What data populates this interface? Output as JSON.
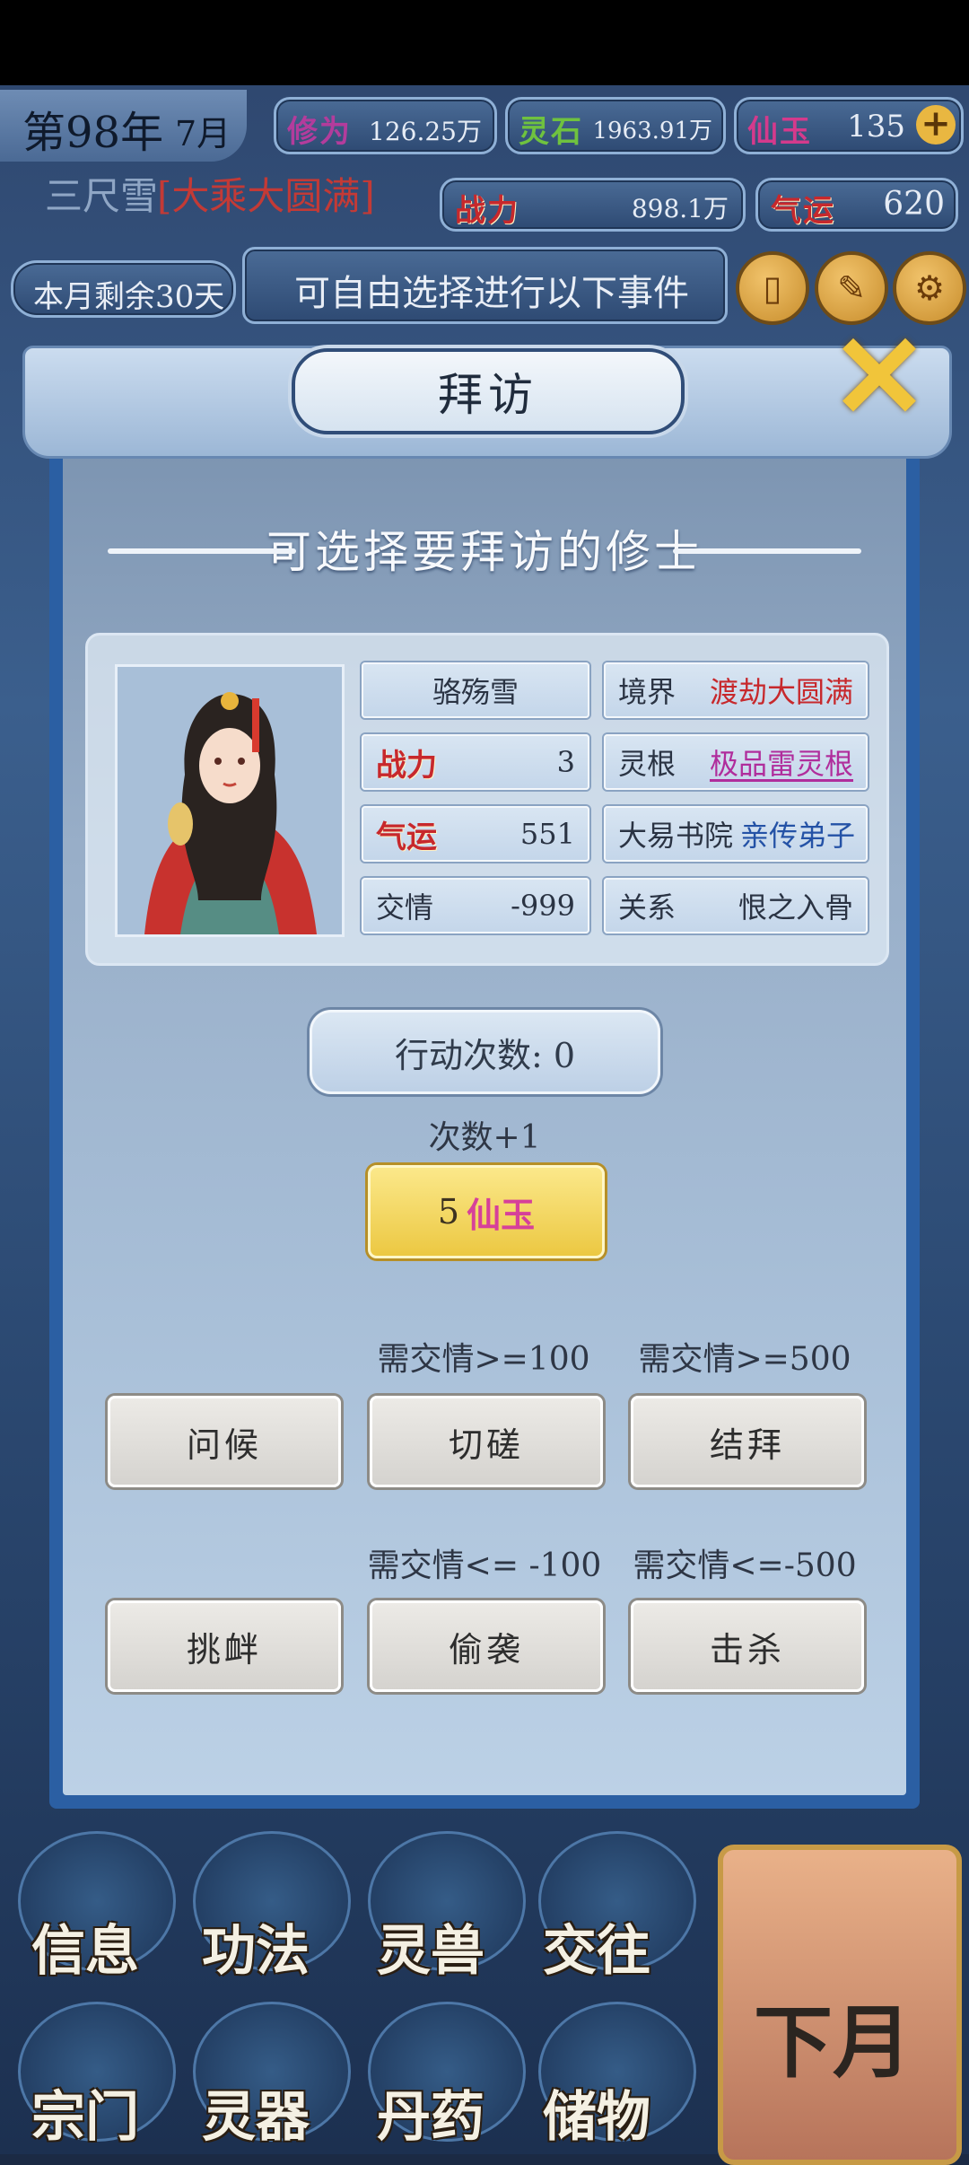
{
  "header": {
    "year": "第98年",
    "month": "7月",
    "stats": [
      {
        "label": "修为",
        "value": "126.25万"
      },
      {
        "label": "灵石",
        "value": "1963.91万"
      },
      {
        "label": "仙玉",
        "value": "135"
      }
    ],
    "player_name": "三尺雪",
    "player_realm": "[大乘大圆满]",
    "combat": {
      "label": "战力",
      "value": "898.1万"
    },
    "luck": {
      "label": "气运",
      "value": "620"
    },
    "days_left": "本月剩余30天",
    "event_text": "可自由选择进行以下事件"
  },
  "dialog": {
    "title": "拜访",
    "subtitle": "可选择要拜访的修士",
    "npc": {
      "name": "骆殇雪",
      "realm_label": "境界",
      "realm_value": "渡劫大圆满",
      "combat_label": "战力",
      "combat_value": "3",
      "root_label": "灵根",
      "root_value": "极品雷灵根",
      "luck_label": "气运",
      "luck_value": "551",
      "sect": "大易书院",
      "sect_role": "亲传弟子",
      "favor_label": "交情",
      "favor_value": "-999",
      "relation_label": "关系",
      "relation_value": "恨之入骨"
    },
    "action_count": "行动次数: 0",
    "plus_note": "次数+1",
    "pay": {
      "amount": "5",
      "currency": "仙玉"
    },
    "actions_row1": [
      {
        "label": "问候",
        "req": ""
      },
      {
        "label": "切磋",
        "req": "需交情>=100"
      },
      {
        "label": "结拜",
        "req": "需交情>=500"
      }
    ],
    "actions_row2": [
      {
        "label": "挑衅",
        "req": ""
      },
      {
        "label": "偷袭",
        "req": "需交情<= -100"
      },
      {
        "label": "击杀",
        "req": "需交情<=-500"
      }
    ]
  },
  "bottom_nav": {
    "row1": [
      "信息",
      "功法",
      "灵兽",
      "交往"
    ],
    "row2": [
      "宗门",
      "灵器",
      "丹药",
      "储物"
    ],
    "next": "下月"
  },
  "colors": {
    "accent_gold": "#ecc842",
    "realm_red": "#c7282c",
    "root_purple": "#b02d9c",
    "role_blue": "#2452a6"
  }
}
